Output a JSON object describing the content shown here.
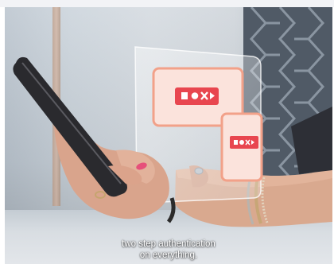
{
  "scene": {
    "caption_line1": "two step authentication",
    "caption_line2": "on everything."
  },
  "colors": {
    "accent_red": "#e8464f",
    "card_border": "#f2a189"
  },
  "icons": [
    "laptop-screen-icon",
    "phone-screen-icon",
    "password-dots-icon"
  ]
}
